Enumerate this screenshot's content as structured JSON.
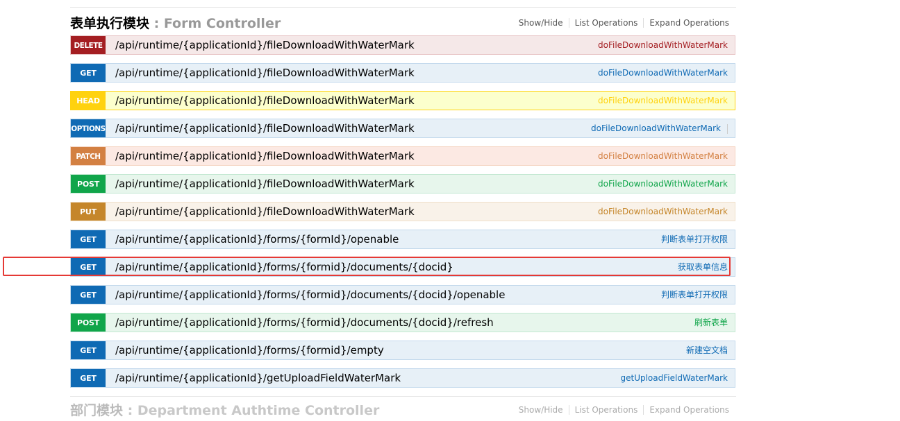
{
  "resource": {
    "title_cn": "表单执行模块",
    "separator": " : ",
    "title_en": "Form Controller",
    "links": [
      "Show/Hide",
      "List Operations",
      "Expand Operations"
    ]
  },
  "operations": [
    {
      "method": "DELETE",
      "path": "/api/runtime/{applicationId}/fileDownloadWithWaterMark",
      "summary": "doFileDownloadWithWaterMark"
    },
    {
      "method": "GET",
      "path": "/api/runtime/{applicationId}/fileDownloadWithWaterMark",
      "summary": "doFileDownloadWithWaterMark"
    },
    {
      "method": "HEAD",
      "path": "/api/runtime/{applicationId}/fileDownloadWithWaterMark",
      "summary": "doFileDownloadWithWaterMark"
    },
    {
      "method": "OPTIONS",
      "path": "/api/runtime/{applicationId}/fileDownloadWithWaterMark",
      "summary": "doFileDownloadWithWaterMark"
    },
    {
      "method": "PATCH",
      "path": "/api/runtime/{applicationId}/fileDownloadWithWaterMark",
      "summary": "doFileDownloadWithWaterMark"
    },
    {
      "method": "POST",
      "path": "/api/runtime/{applicationId}/fileDownloadWithWaterMark",
      "summary": "doFileDownloadWithWaterMark"
    },
    {
      "method": "PUT",
      "path": "/api/runtime/{applicationId}/fileDownloadWithWaterMark",
      "summary": "doFileDownloadWithWaterMark"
    },
    {
      "method": "GET",
      "path": "/api/runtime/{applicationId}/forms/{formId}/openable",
      "summary": "判断表单打开权限"
    },
    {
      "method": "GET",
      "path": "/api/runtime/{applicationId}/forms/{formid}/documents/{docid}",
      "summary": "获取表单信息"
    },
    {
      "method": "GET",
      "path": "/api/runtime/{applicationId}/forms/{formid}/documents/{docid}/openable",
      "summary": "判断表单打开权限"
    },
    {
      "method": "POST",
      "path": "/api/runtime/{applicationId}/forms/{formid}/documents/{docid}/refresh",
      "summary": "刷新表单"
    },
    {
      "method": "GET",
      "path": "/api/runtime/{applicationId}/forms/{formid}/empty",
      "summary": "新建空文档"
    },
    {
      "method": "GET",
      "path": "/api/runtime/{applicationId}/getUploadFieldWaterMark",
      "summary": "getUploadFieldWaterMark"
    }
  ],
  "next_resource": {
    "title_cn": "部门模块",
    "separator": " : ",
    "title_en": "Department Authtime Controller",
    "links": [
      "Show/Hide",
      "List Operations",
      "Expand Operations"
    ]
  }
}
